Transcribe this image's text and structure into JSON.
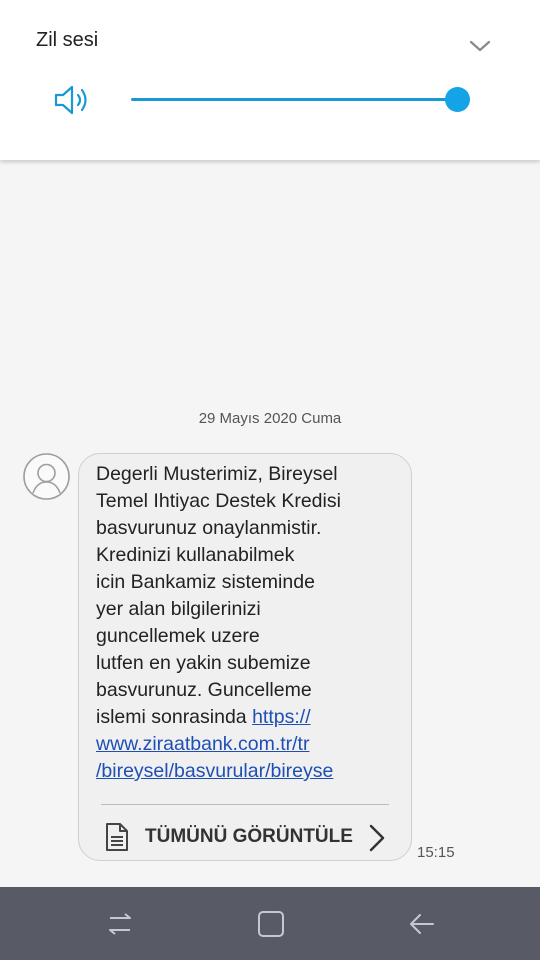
{
  "volume": {
    "title": "Zil sesi",
    "level": 1.0,
    "icons": {
      "speaker": "speaker-icon",
      "collapse": "chevron-down-icon"
    },
    "accent_color": "#14a3e6"
  },
  "conversation": {
    "date": "29 Mayıs 2020 Cuma",
    "message": {
      "text": "Degerli Musterimiz, Bireysel\nTemel Ihtiyac Destek Kredisi\nbasvurunuz onaylanmistir.\nKredinizi kullanabilmek\nicin Bankamiz sisteminde\nyer alan bilgilerinizi\nguncellemek uzere\nlutfen en yakin subemize\nbasvurunuz. Guncelleme\nislemi sonrasinda ",
      "link": "https://\nwww.ziraatbank.com.tr/tr\n/bireysel/basvurular/bireyse",
      "view_all_label": "TÜMÜNÜ GÖRÜNTÜLE",
      "time": "15:15",
      "link_color": "#1f4fb5"
    }
  },
  "navigation": {
    "buttons": [
      "recent-apps-icon",
      "home-icon",
      "back-icon"
    ],
    "background_color": "#585a66"
  }
}
